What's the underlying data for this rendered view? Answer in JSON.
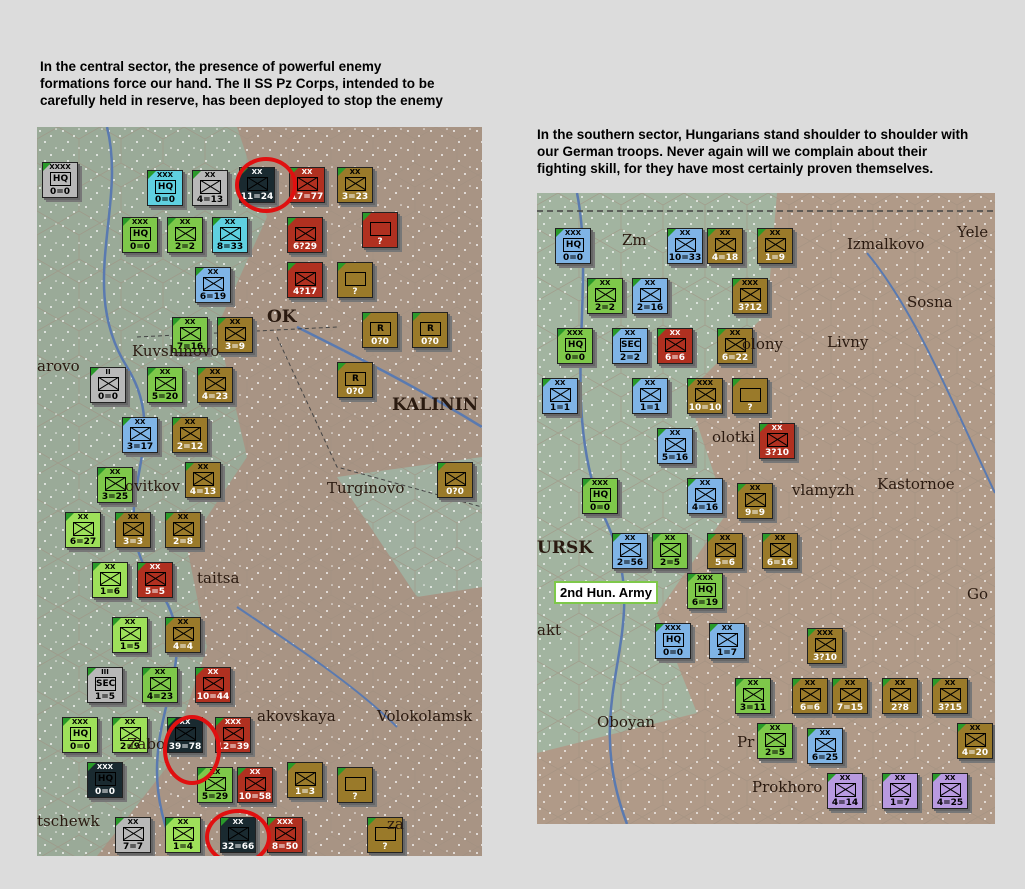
{
  "captions": {
    "left": "In the central sector, the presence of powerful enemy\nformations force our hand. The II SS Pz Corps, intended to be\ncarefully held in reserve, has been deployed to stop the enemy",
    "right": "In the southern sector, Hungarians stand shoulder to shoulder with\nour German troops. Never again will we complain about their\nfighting skill, for they have most certainly proven themselves."
  },
  "left_map": {
    "places": [
      "OK",
      "Kuvshinovo",
      "arovo",
      "KALININ",
      "Turginovo",
      "ovitkov",
      "taitsa",
      "Zabo",
      "Volokolamsk",
      "akovskaya",
      "tschewk",
      "za"
    ],
    "units": [
      {
        "size": "XXXX",
        "label": "HQ",
        "value": "0=0",
        "color": "gray"
      },
      {
        "size": "XXX",
        "label": "HQ",
        "value": "0=0",
        "color": "cyan"
      },
      {
        "size": "XX",
        "label": "",
        "value": "4=13",
        "color": "gray"
      },
      {
        "size": "XX",
        "label": "",
        "value": "11=24",
        "color": "dark"
      },
      {
        "size": "XX",
        "label": "",
        "value": "17=77",
        "color": "red"
      },
      {
        "size": "XX",
        "label": "",
        "value": "3=23",
        "color": "olive"
      },
      {
        "size": "XXX",
        "label": "HQ",
        "value": "0=0",
        "color": "green"
      },
      {
        "size": "XX",
        "label": "",
        "value": "2=2",
        "color": "green"
      },
      {
        "size": "XX",
        "label": "",
        "value": "8=33",
        "color": "cyan"
      },
      {
        "size": "",
        "label": "",
        "value": "6?29",
        "color": "red"
      },
      {
        "size": "",
        "label": "",
        "value": "?",
        "color": "red"
      },
      {
        "size": "XX",
        "label": "",
        "value": "6=19",
        "color": "blue"
      },
      {
        "size": "",
        "label": "",
        "value": "4?17",
        "color": "red"
      },
      {
        "size": "",
        "label": "",
        "value": "?",
        "color": "olive"
      },
      {
        "size": "XX",
        "label": "",
        "value": "7=16",
        "color": "green"
      },
      {
        "size": "XX",
        "label": "",
        "value": "3=9",
        "color": "olive"
      },
      {
        "size": "",
        "label": "R",
        "value": "0?0",
        "color": "olive"
      },
      {
        "size": "",
        "label": "R",
        "value": "0?0",
        "color": "olive"
      },
      {
        "size": "II",
        "label": "",
        "value": "0=0",
        "color": "gray"
      },
      {
        "size": "XX",
        "label": "",
        "value": "5=20",
        "color": "green"
      },
      {
        "size": "XX",
        "label": "",
        "value": "4=23",
        "color": "olive"
      },
      {
        "size": "",
        "label": "R",
        "value": "0?0",
        "color": "olive"
      },
      {
        "size": "XX",
        "label": "",
        "value": "3=17",
        "color": "blue"
      },
      {
        "size": "XX",
        "label": "",
        "value": "2=12",
        "color": "olive"
      },
      {
        "size": "XX",
        "label": "",
        "value": "3=25",
        "color": "green"
      },
      {
        "size": "XX",
        "label": "",
        "value": "4=13",
        "color": "olive"
      },
      {
        "size": "",
        "label": "",
        "value": "0?0",
        "color": "olive"
      },
      {
        "size": "XX",
        "label": "",
        "value": "6=27",
        "color": "lime"
      },
      {
        "size": "XX",
        "label": "",
        "value": "3=3",
        "color": "olive"
      },
      {
        "size": "XX",
        "label": "",
        "value": "2=8",
        "color": "olive"
      },
      {
        "size": "XX",
        "label": "",
        "value": "1=6",
        "color": "lime"
      },
      {
        "size": "XX",
        "label": "",
        "value": "5=5",
        "color": "red"
      },
      {
        "size": "XX",
        "label": "",
        "value": "1=5",
        "color": "lime"
      },
      {
        "size": "XX",
        "label": "",
        "value": "4=4",
        "color": "olive"
      },
      {
        "size": "III",
        "label": "SEC",
        "value": "1=5",
        "color": "gray"
      },
      {
        "size": "XX",
        "label": "",
        "value": "4=23",
        "color": "green"
      },
      {
        "size": "XX",
        "label": "",
        "value": "10=44",
        "color": "red"
      },
      {
        "size": "XXX",
        "label": "HQ",
        "value": "0=0",
        "color": "lime"
      },
      {
        "size": "XX",
        "label": "",
        "value": "2=9",
        "color": "lime"
      },
      {
        "size": "XX",
        "label": "",
        "value": "39=78",
        "color": "dark"
      },
      {
        "size": "XXX",
        "label": "",
        "value": "12=39",
        "color": "red"
      },
      {
        "size": "XXX",
        "label": "HQ",
        "value": "0=0",
        "color": "dark"
      },
      {
        "size": "XX",
        "label": "",
        "value": "5=29",
        "color": "green"
      },
      {
        "size": "XX",
        "label": "",
        "value": "10=58",
        "color": "red"
      },
      {
        "size": "",
        "label": "",
        "value": "1=3",
        "color": "olive"
      },
      {
        "size": "",
        "label": "",
        "value": "?",
        "color": "olive"
      },
      {
        "size": "XX",
        "label": "",
        "value": "7=7",
        "color": "gray"
      },
      {
        "size": "XX",
        "label": "",
        "value": "1=4",
        "color": "lime"
      },
      {
        "size": "XX",
        "label": "",
        "value": "32=66",
        "color": "dark"
      },
      {
        "size": "XXX",
        "label": "",
        "value": "8=50",
        "color": "red"
      },
      {
        "size": "",
        "label": "",
        "value": "?",
        "color": "olive"
      }
    ]
  },
  "right_map": {
    "places": [
      "Zm",
      "Izmalkovo",
      "Yele",
      "Sosna",
      "Livny",
      "olony",
      "olotki",
      "vlamyzh",
      "Kastornoe",
      "URSK",
      "Oboyan",
      "Pr",
      "Prokhoro",
      "Go",
      "akt"
    ],
    "box_label": "2nd Hun. Army",
    "units": [
      {
        "size": "XXX",
        "label": "HQ",
        "value": "0=0",
        "color": "blue"
      },
      {
        "size": "XX",
        "label": "",
        "value": "10=33",
        "color": "blue"
      },
      {
        "size": "XX",
        "label": "",
        "value": "4=18",
        "color": "olive"
      },
      {
        "size": "XX",
        "label": "",
        "value": "1=9",
        "color": "olive"
      },
      {
        "size": "XX",
        "label": "",
        "value": "2=2",
        "color": "green"
      },
      {
        "size": "XX",
        "label": "",
        "value": "2=16",
        "color": "blue"
      },
      {
        "size": "XXX",
        "label": "",
        "value": "3?12",
        "color": "olive"
      },
      {
        "size": "XXX",
        "label": "HQ",
        "value": "0=0",
        "color": "green"
      },
      {
        "size": "XX",
        "label": "SEC",
        "value": "2=2",
        "color": "blue"
      },
      {
        "size": "XX",
        "label": "",
        "value": "6=6",
        "color": "red"
      },
      {
        "size": "XX",
        "label": "",
        "value": "6=22",
        "color": "olive"
      },
      {
        "size": "XX",
        "label": "",
        "value": "1=1",
        "color": "blue"
      },
      {
        "size": "XX",
        "label": "",
        "value": "1=1",
        "color": "blue"
      },
      {
        "size": "XXX",
        "label": "",
        "value": "10=10",
        "color": "olive"
      },
      {
        "size": "",
        "label": "",
        "value": "?",
        "color": "olive"
      },
      {
        "size": "XX",
        "label": "",
        "value": "5=16",
        "color": "blue"
      },
      {
        "size": "XX",
        "label": "",
        "value": "3?10",
        "color": "red"
      },
      {
        "size": "XXX",
        "label": "HQ",
        "value": "0=0",
        "color": "green"
      },
      {
        "size": "XX",
        "label": "",
        "value": "4=16",
        "color": "blue"
      },
      {
        "size": "XX",
        "label": "",
        "value": "9=9",
        "color": "olive"
      },
      {
        "size": "XX",
        "label": "",
        "value": "2=56",
        "color": "blue"
      },
      {
        "size": "XX",
        "label": "",
        "value": "2=5",
        "color": "green"
      },
      {
        "size": "XX",
        "label": "",
        "value": "5=6",
        "color": "olive"
      },
      {
        "size": "XX",
        "label": "",
        "value": "6=16",
        "color": "olive"
      },
      {
        "size": "XXX",
        "label": "HQ",
        "value": "6=19",
        "color": "green"
      },
      {
        "size": "XXX",
        "label": "HQ",
        "value": "0=0",
        "color": "blue"
      },
      {
        "size": "XX",
        "label": "",
        "value": "1=7",
        "color": "blue"
      },
      {
        "size": "XXX",
        "label": "",
        "value": "3?10",
        "color": "olive"
      },
      {
        "size": "XX",
        "label": "",
        "value": "3=11",
        "color": "green"
      },
      {
        "size": "XX",
        "label": "",
        "value": "6=6",
        "color": "olive"
      },
      {
        "size": "XX",
        "label": "",
        "value": "7=15",
        "color": "olive"
      },
      {
        "size": "XX",
        "label": "",
        "value": "2?8",
        "color": "olive"
      },
      {
        "size": "XX",
        "label": "",
        "value": "3?15",
        "color": "olive"
      },
      {
        "size": "XX",
        "label": "",
        "value": "2=5",
        "color": "green"
      },
      {
        "size": "XX",
        "label": "",
        "value": "6=25",
        "color": "blue"
      },
      {
        "size": "XX",
        "label": "",
        "value": "4=20",
        "color": "olive"
      },
      {
        "size": "XX",
        "label": "",
        "value": "4=14",
        "color": "purple"
      },
      {
        "size": "XX",
        "label": "",
        "value": "1=7",
        "color": "purple"
      },
      {
        "size": "XX",
        "label": "",
        "value": "4=25",
        "color": "purple"
      }
    ]
  }
}
